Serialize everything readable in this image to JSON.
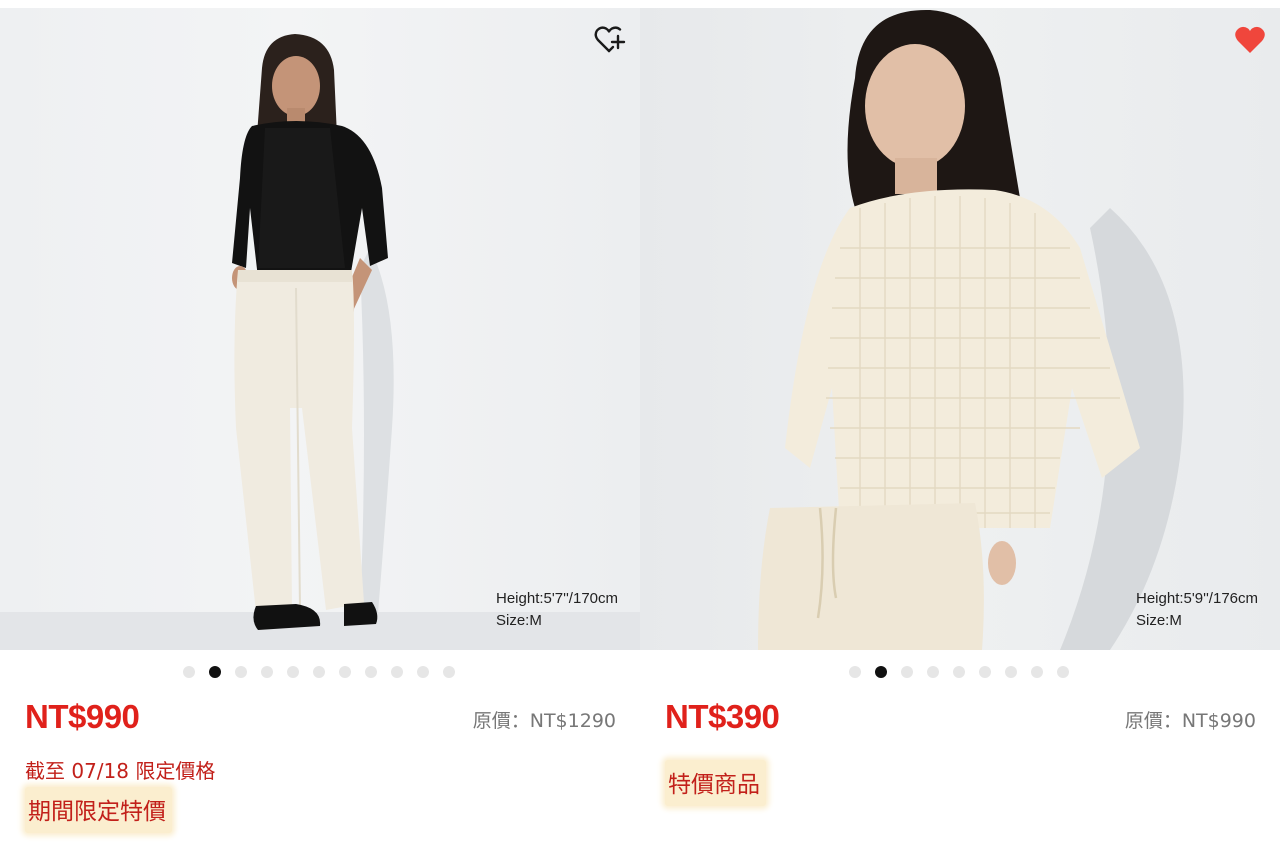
{
  "products": [
    {
      "model_height": "Height:5'7''/170cm",
      "model_size": "Size:M",
      "favorite_icon": "heart-plus-icon",
      "favorited": false,
      "carousel": {
        "total": 11,
        "active": 1
      },
      "price": "NT$990",
      "original_price": "原價：NT$1290",
      "limited_note": "截至 07/18 限定價格",
      "badge": "期間限定特價"
    },
    {
      "model_height": "Height:5'9''/176cm",
      "model_size": "Size:M",
      "favorite_icon": "heart-filled-icon",
      "favorited": true,
      "carousel": {
        "total": 9,
        "active": 1
      },
      "price": "NT$390",
      "original_price": "原價：NT$990",
      "badge": "特價商品"
    }
  ],
  "colors": {
    "price_red": "#e0211b",
    "badge_text": "#c2201a",
    "badge_bg": "#fbeecf",
    "favorite_active": "#f0463c",
    "dot_active": "#111111",
    "dot_inactive": "#e6e6e6"
  }
}
